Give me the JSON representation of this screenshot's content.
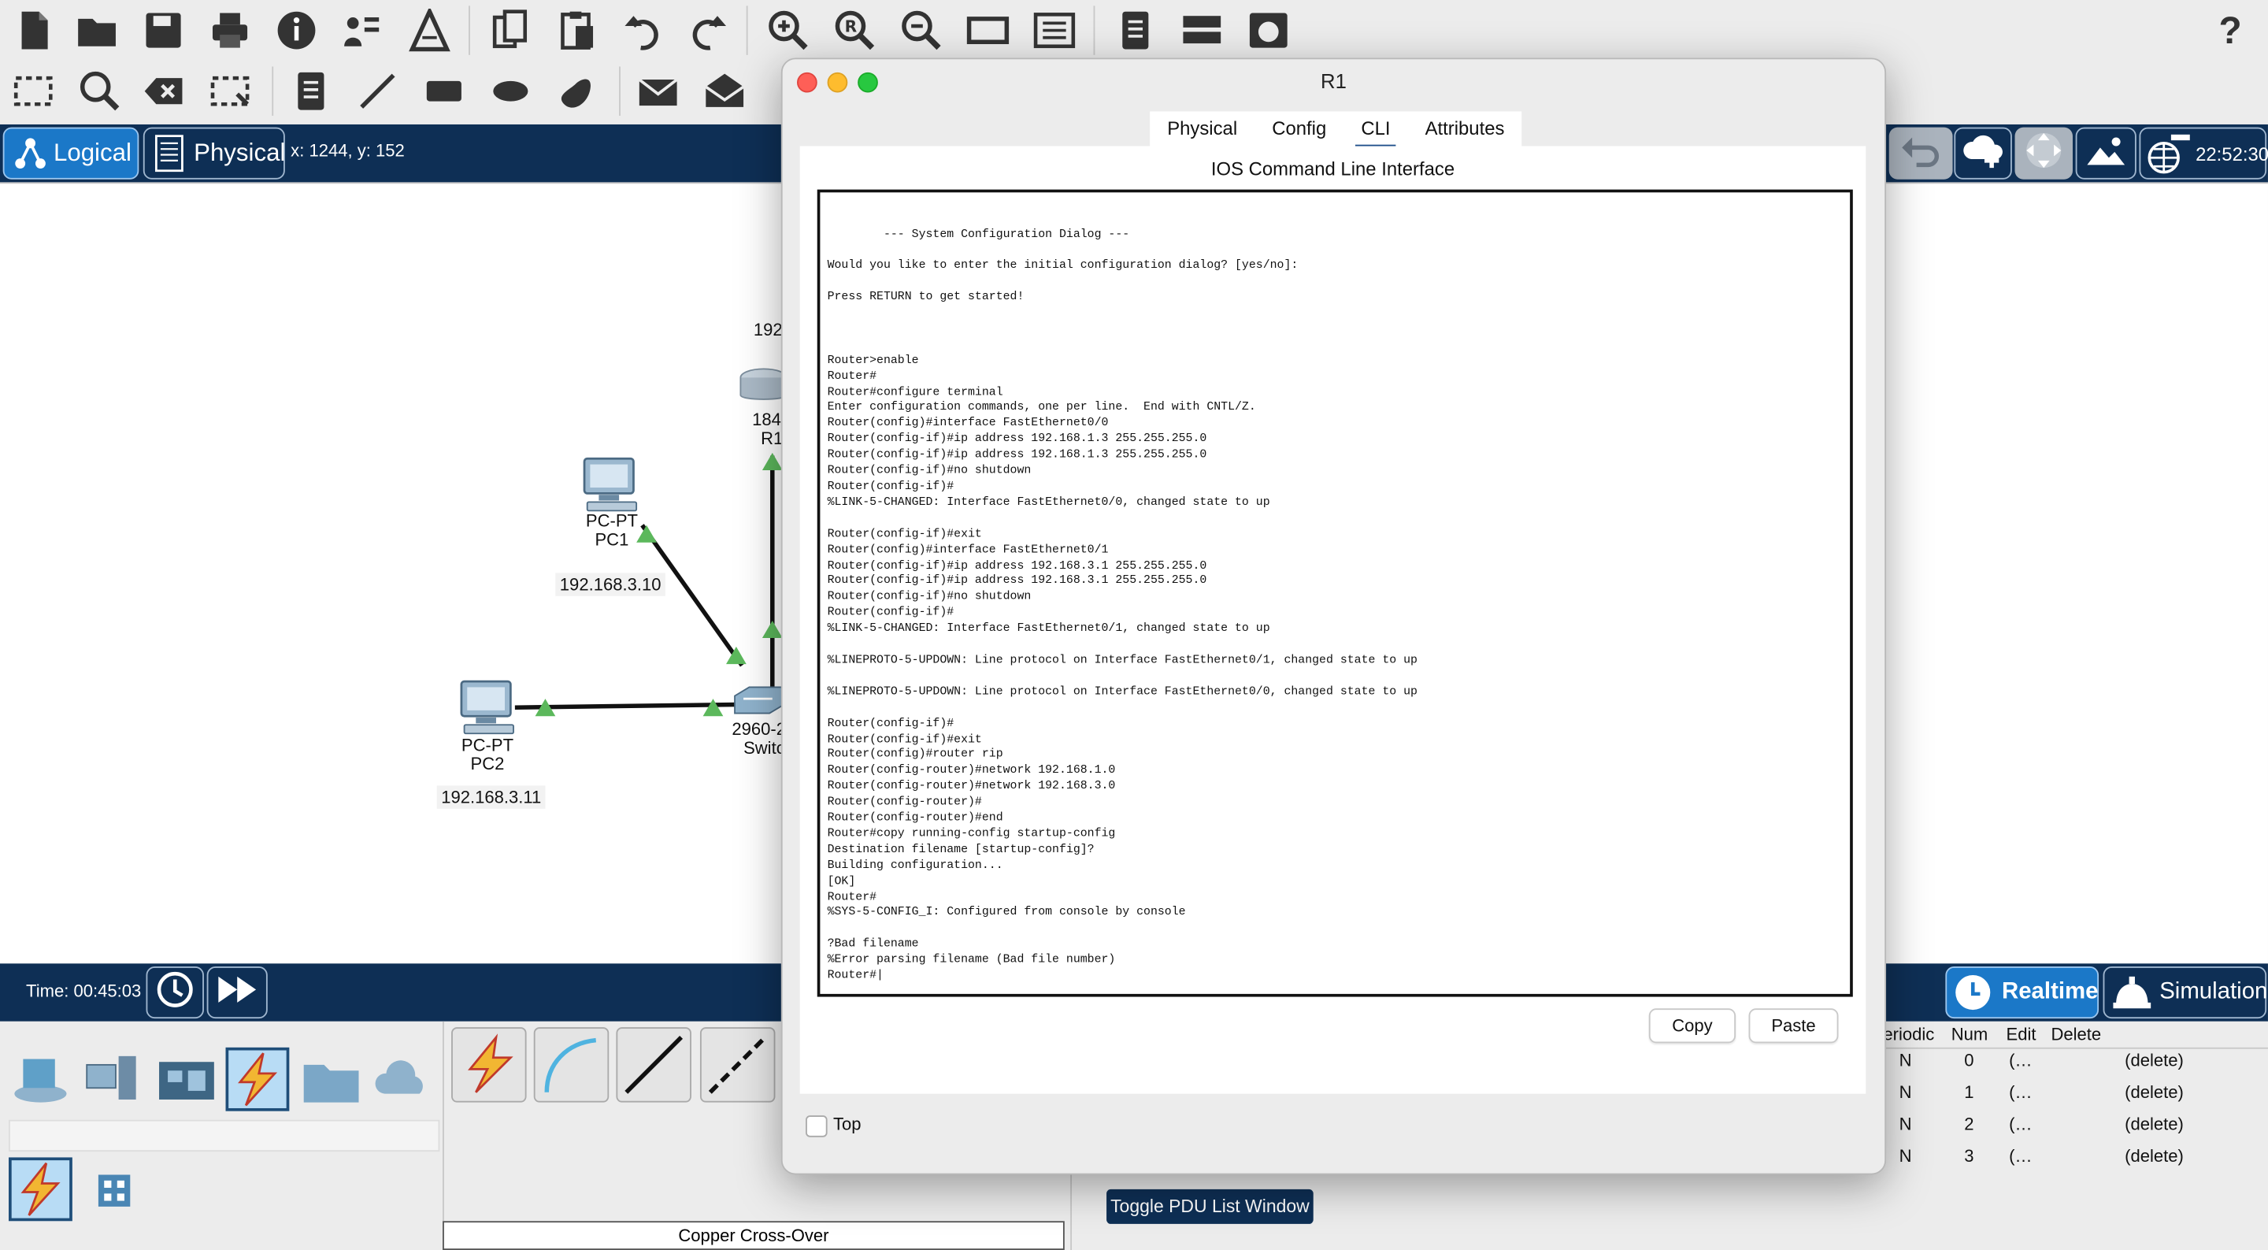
{
  "toolbar": {
    "help": "?"
  },
  "modebar": {
    "logical": "Logical",
    "physical": "Physical",
    "coords": "x: 1244, y: 152",
    "clock": "22:52:30"
  },
  "topology": {
    "pc1": {
      "type": "PC-PT",
      "name": "PC1",
      "ip": "192.168.3.10"
    },
    "pc2": {
      "type": "PC-PT",
      "name": "PC2",
      "ip": "192.168.3.11"
    },
    "router": {
      "ip_partial": "192",
      "model_partial": "184",
      "name_partial": "R1"
    },
    "switch": {
      "model_partial": "2960-2",
      "name_partial": "Switc"
    }
  },
  "bottombar": {
    "time": "Time: 00:45:03",
    "realtime": "Realtime",
    "simulation": "Simulation"
  },
  "devices": {
    "cable_name": "Copper Cross-Over",
    "toggle_pdu": "Toggle PDU List Window"
  },
  "pdu_table": {
    "headers": [
      "eriodic",
      "Num",
      "Edit",
      "Delete"
    ],
    "rows": [
      {
        "periodic": "N",
        "num": "0",
        "edit": "(…",
        "delete": "(delete)"
      },
      {
        "periodic": "N",
        "num": "1",
        "edit": "(…",
        "delete": "(delete)"
      },
      {
        "periodic": "N",
        "num": "2",
        "edit": "(…",
        "delete": "(delete)"
      },
      {
        "periodic": "N",
        "num": "3",
        "edit": "(…",
        "delete": "(delete)"
      }
    ]
  },
  "dialog": {
    "title": "R1",
    "tabs": [
      "Physical",
      "Config",
      "CLI",
      "Attributes"
    ],
    "active_tab": "CLI",
    "heading": "IOS Command Line Interface",
    "copy": "Copy",
    "paste": "Paste",
    "top_label": "Top",
    "terminal": "        --- System Configuration Dialog ---\n\nWould you like to enter the initial configuration dialog? [yes/no]:\n\nPress RETURN to get started!\n\n\n\nRouter>enable\nRouter#\nRouter#configure terminal\nEnter configuration commands, one per line.  End with CNTL/Z.\nRouter(config)#interface FastEthernet0/0\nRouter(config-if)#ip address 192.168.1.3 255.255.255.0\nRouter(config-if)#ip address 192.168.1.3 255.255.255.0\nRouter(config-if)#no shutdown\nRouter(config-if)#\n%LINK-5-CHANGED: Interface FastEthernet0/0, changed state to up\n\nRouter(config-if)#exit\nRouter(config)#interface FastEthernet0/1\nRouter(config-if)#ip address 192.168.3.1 255.255.255.0\nRouter(config-if)#ip address 192.168.3.1 255.255.255.0\nRouter(config-if)#no shutdown\nRouter(config-if)#\n%LINK-5-CHANGED: Interface FastEthernet0/1, changed state to up\n\n%LINEPROTO-5-UPDOWN: Line protocol on Interface FastEthernet0/1, changed state to up\n\n%LINEPROTO-5-UPDOWN: Line protocol on Interface FastEthernet0/0, changed state to up\n\nRouter(config-if)#\nRouter(config-if)#exit\nRouter(config)#router rip\nRouter(config-router)#network 192.168.1.0\nRouter(config-router)#network 192.168.3.0\nRouter(config-router)#\nRouter(config-router)#end\nRouter#copy running-config startup-config\nDestination filename [startup-config]?\nBuilding configuration...\n[OK]\nRouter#\n%SYS-5-CONFIG_I: Configured from console by console\n\n?Bad filename\n%Error parsing filename (Bad file number)\nRouter#|"
  },
  "colors": {
    "navy": "#0e2f55",
    "accent_blue": "#1b78c8",
    "link_green": "#5cb85c"
  }
}
